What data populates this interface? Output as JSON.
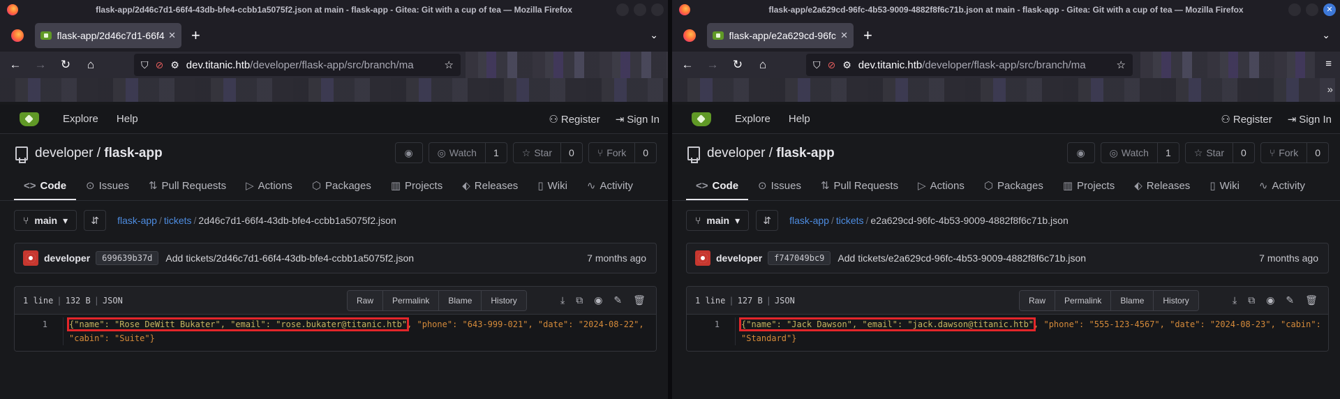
{
  "left": {
    "window_title": "flask-app/2d46c7d1-66f4-43db-bfe4-ccbb1a5075f2.json at main - flask-app - Gitea: Git with a cup of tea — Mozilla Firefox",
    "tab_title": "flask-app/2d46c7d1-66f4",
    "url_domain": "dev.titanic.htb",
    "url_path": "/developer/flask-app/src/branch/ma",
    "nav": {
      "explore": "Explore",
      "help": "Help",
      "register": "Register",
      "signin": "Sign In"
    },
    "repo": {
      "owner": "developer",
      "sep": " / ",
      "name": "flask-app"
    },
    "watch": {
      "label": "Watch",
      "count": "1"
    },
    "star": {
      "label": "Star",
      "count": "0"
    },
    "fork": {
      "label": "Fork",
      "count": "0"
    },
    "tabs": [
      "Code",
      "Issues",
      "Pull Requests",
      "Actions",
      "Packages",
      "Projects",
      "Releases",
      "Wiki",
      "Activity"
    ],
    "branch": "main",
    "crumb_repo": "flask-app",
    "crumb_dir": "tickets",
    "crumb_file": "2d46c7d1-66f4-43db-bfe4-ccbb1a5075f2.json",
    "commit": {
      "author": "developer",
      "sha": "699639b37d",
      "message": "Add tickets/2d46c7d1-66f4-43db-bfe4-ccbb1a5075f2.json",
      "time": "7 months ago"
    },
    "file": {
      "lines": "1 line",
      "size": "132 B",
      "type": "JSON",
      "raw": "Raw",
      "permalink": "Permalink",
      "blame": "Blame",
      "history": "History"
    },
    "line_number": "1",
    "code_highlighted": "{\"name\": \"Rose DeWitt Bukater\", \"email\": \"rose.bukater@titanic.htb\"",
    "code_rest": ", \"phone\": \"643-999-021\", \"date\": \"2024-08-22\", \"cabin\": \"Suite\"}"
  },
  "right": {
    "window_title": "flask-app/e2a629cd-96fc-4b53-9009-4882f8f6c71b.json at main - flask-app - Gitea: Git with a cup of tea — Mozilla Firefox",
    "tab_title": "flask-app/e2a629cd-96fc",
    "url_domain": "dev.titanic.htb",
    "url_path": "/developer/flask-app/src/branch/ma",
    "nav": {
      "explore": "Explore",
      "help": "Help",
      "register": "Register",
      "signin": "Sign In"
    },
    "repo": {
      "owner": "developer",
      "sep": " / ",
      "name": "flask-app"
    },
    "watch": {
      "label": "Watch",
      "count": "1"
    },
    "star": {
      "label": "Star",
      "count": "0"
    },
    "fork": {
      "label": "Fork",
      "count": "0"
    },
    "tabs": [
      "Code",
      "Issues",
      "Pull Requests",
      "Actions",
      "Packages",
      "Projects",
      "Releases",
      "Wiki",
      "Activity"
    ],
    "branch": "main",
    "crumb_repo": "flask-app",
    "crumb_dir": "tickets",
    "crumb_file": "e2a629cd-96fc-4b53-9009-4882f8f6c71b.json",
    "commit": {
      "author": "developer",
      "sha": "f747049bc9",
      "message": "Add tickets/e2a629cd-96fc-4b53-9009-4882f8f6c71b.json",
      "time": "7 months ago"
    },
    "file": {
      "lines": "1 line",
      "size": "127 B",
      "type": "JSON",
      "raw": "Raw",
      "permalink": "Permalink",
      "blame": "Blame",
      "history": "History"
    },
    "line_number": "1",
    "code_highlighted": "{\"name\": \"Jack Dawson\", \"email\": \"jack.dawson@titanic.htb\"",
    "code_rest": ", \"phone\": \"555-123-4567\", \"date\": \"2024-08-23\", \"cabin\": \"Standard\"}"
  },
  "icons": {
    "back": "←",
    "forward": "→",
    "reload": "↻",
    "home": "⌂",
    "shield": "⛉",
    "lock": "🔒",
    "star": "☆",
    "rss": "◉",
    "eye": "◎",
    "fork": "⑂",
    "code": "<>",
    "issue": "⊙",
    "pr": "⇅",
    "actions": "▷",
    "package": "⬡",
    "projects": "▥",
    "tag": "⬖",
    "wiki": "▯",
    "activity": "∿",
    "branch": "⑂",
    "user": "⚇",
    "signin": "⇥"
  },
  "accent_link": "#4d8ce0",
  "highlight_box": "#e3262a"
}
